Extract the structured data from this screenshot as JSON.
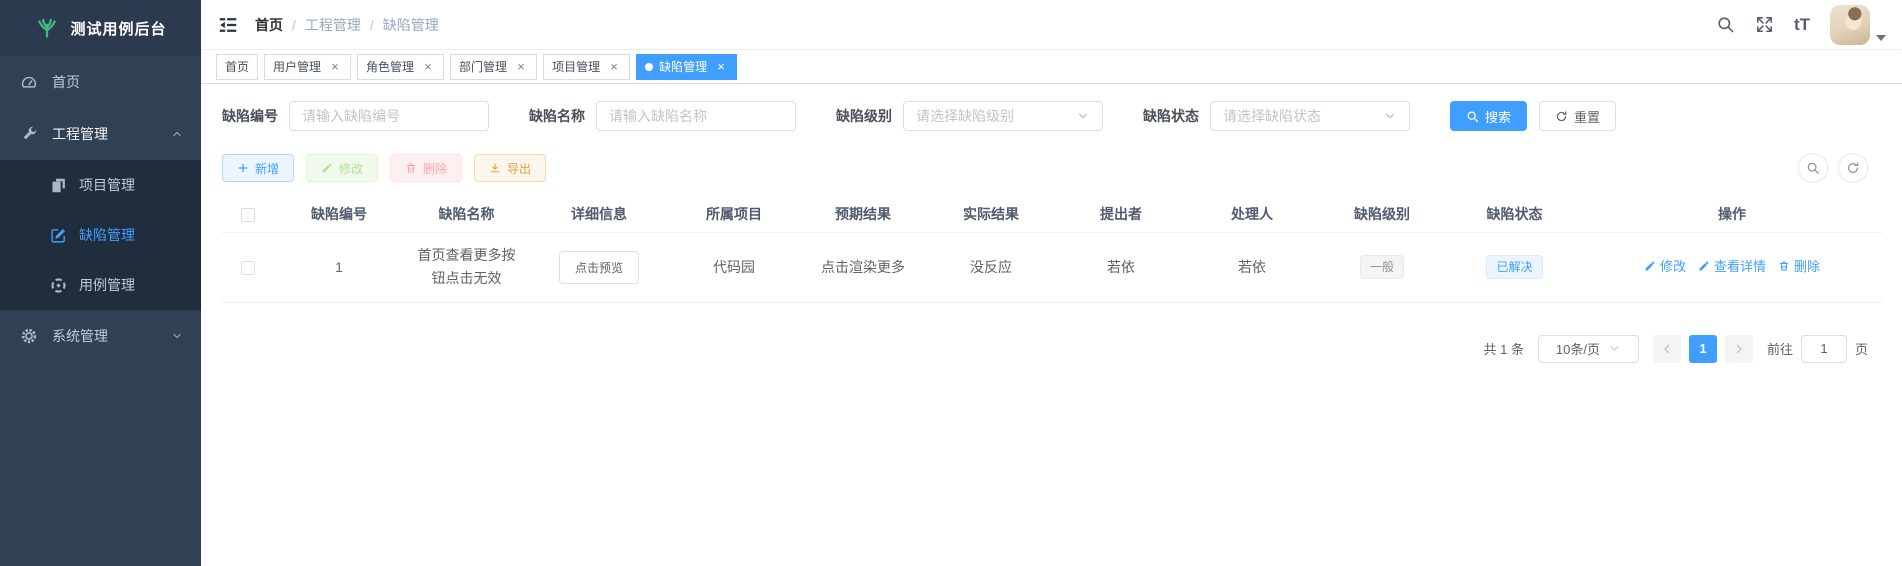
{
  "app_title": "测试用例后台",
  "sidebar": {
    "home": "首页",
    "engineering": "工程管理",
    "project": "项目管理",
    "defect": "缺陷管理",
    "testcase": "用例管理",
    "system": "系统管理"
  },
  "breadcrumb": {
    "items": [
      "首页",
      "工程管理",
      "缺陷管理"
    ]
  },
  "tabs": [
    {
      "label": "首页",
      "active": false,
      "closable": false
    },
    {
      "label": "用户管理",
      "active": false,
      "closable": true
    },
    {
      "label": "角色管理",
      "active": false,
      "closable": true
    },
    {
      "label": "部门管理",
      "active": false,
      "closable": true
    },
    {
      "label": "项目管理",
      "active": false,
      "closable": true
    },
    {
      "label": "缺陷管理",
      "active": true,
      "closable": true
    }
  ],
  "header_icons": {
    "font_size_text": "tT"
  },
  "filters": {
    "defect_no_label": "缺陷编号",
    "defect_no_placeholder": "请输入缺陷编号",
    "defect_name_label": "缺陷名称",
    "defect_name_placeholder": "请输入缺陷名称",
    "defect_level_label": "缺陷级别",
    "defect_level_placeholder": "请选择缺陷级别",
    "defect_status_label": "缺陷状态",
    "defect_status_placeholder": "请选择缺陷状态",
    "search_label": "搜索",
    "reset_label": "重置"
  },
  "toolbar": {
    "add_label": "新增",
    "edit_label": "修改",
    "delete_label": "删除",
    "export_label": "导出"
  },
  "table": {
    "columns": [
      "缺陷编号",
      "缺陷名称",
      "详细信息",
      "所属项目",
      "预期结果",
      "实际结果",
      "提出者",
      "处理人",
      "缺陷级别",
      "缺陷状态",
      "操作"
    ],
    "rows": [
      {
        "defect_no": "1",
        "defect_name": "首页查看更多按钮点击无效",
        "detail_button": "点击预览",
        "project": "代码园",
        "expected": "点击渲染更多",
        "actual": "没反应",
        "reporter": "若依",
        "handler": "若依",
        "level": "一般",
        "status": "已解决",
        "actions": [
          "修改",
          "查看详情",
          "删除"
        ]
      }
    ]
  },
  "pagination": {
    "total_text": "共 1 条",
    "page_size_text": "10条/页",
    "current_page": "1",
    "goto_label": "前往",
    "goto_value": "1",
    "page_unit": "页"
  },
  "colors": {
    "accent": "#409eff",
    "sidebar_bg": "#304156",
    "submenu_bg": "#1f2d3d",
    "logo_green": "#42b983",
    "success": "#67c23a",
    "danger": "#f56c6c",
    "warning": "#e6a23c",
    "tag_info_text": "#909399"
  }
}
